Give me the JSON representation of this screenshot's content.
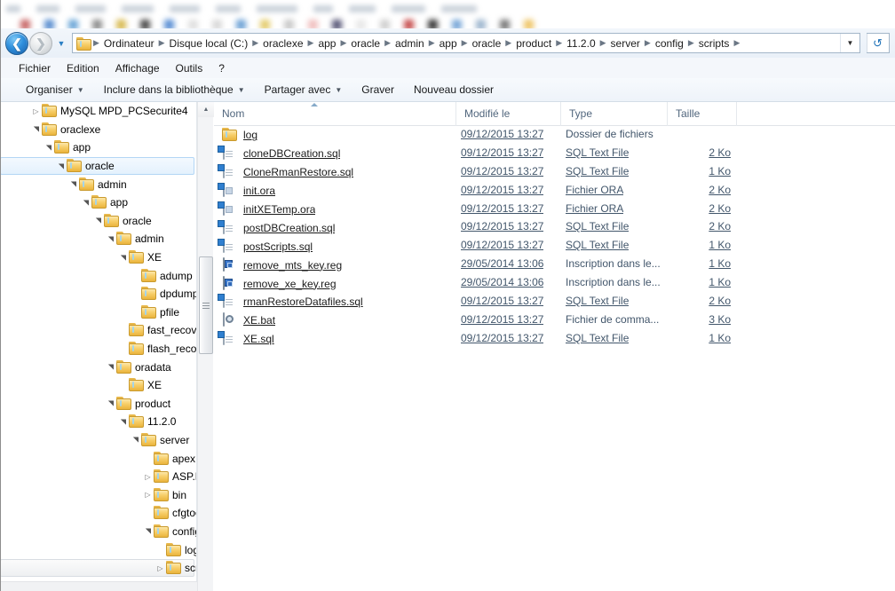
{
  "window": {
    "blur_tabs": [
      "",
      "",
      "",
      "",
      "",
      "",
      "",
      "",
      "",
      ""
    ]
  },
  "addressbar": {
    "back_icon": "arrow-left-icon",
    "forward_icon": "arrow-right-icon",
    "history_icon": "chevron-down-icon",
    "folder_icon": "folder-icon",
    "dropdown_icon": "chevron-down-icon",
    "refresh_icon": "refresh-icon",
    "breadcrumbs": [
      "Ordinateur",
      "Disque local (C:)",
      "oraclexe",
      "app",
      "oracle",
      "admin",
      "app",
      "oracle",
      "product",
      "11.2.0",
      "server",
      "config",
      "scripts"
    ]
  },
  "menubar": {
    "items": [
      "Fichier",
      "Edition",
      "Affichage",
      "Outils",
      "?"
    ]
  },
  "toolbar": {
    "items": [
      {
        "label": "Organiser",
        "caret": true
      },
      {
        "label": "Inclure dans la bibliothèque",
        "caret": true
      },
      {
        "label": "Partager avec",
        "caret": true
      },
      {
        "label": "Graver",
        "caret": false
      },
      {
        "label": "Nouveau dossier",
        "caret": false
      }
    ]
  },
  "tree": {
    "scroll_up_icon": "triangle-up-icon",
    "items": [
      {
        "label": "MySQL MPD_PCSecurite4",
        "indent": 2,
        "twisty": "collapsed",
        "state": "normal"
      },
      {
        "label": "oraclexe",
        "indent": 2,
        "twisty": "expanded",
        "state": "normal"
      },
      {
        "label": "app",
        "indent": 3,
        "twisty": "expanded",
        "state": "normal"
      },
      {
        "label": "oracle",
        "indent": 4,
        "twisty": "expanded",
        "state": "selected"
      },
      {
        "label": "admin",
        "indent": 5,
        "twisty": "expanded",
        "state": "normal"
      },
      {
        "label": "app",
        "indent": 6,
        "twisty": "expanded",
        "state": "normal"
      },
      {
        "label": "oracle",
        "indent": 7,
        "twisty": "expanded",
        "state": "normal"
      },
      {
        "label": "admin",
        "indent": 8,
        "twisty": "expanded",
        "state": "normal"
      },
      {
        "label": "XE",
        "indent": 9,
        "twisty": "expanded",
        "state": "normal"
      },
      {
        "label": "adump",
        "indent": 10,
        "twisty": "none",
        "state": "normal"
      },
      {
        "label": "dpdump",
        "indent": 10,
        "twisty": "none",
        "state": "normal"
      },
      {
        "label": "pfile",
        "indent": 10,
        "twisty": "none",
        "state": "normal"
      },
      {
        "label": "fast_recovery_a",
        "indent": 9,
        "twisty": "none",
        "state": "normal"
      },
      {
        "label": "flash_recovery_",
        "indent": 9,
        "twisty": "none",
        "state": "normal"
      },
      {
        "label": "oradata",
        "indent": 8,
        "twisty": "expanded",
        "state": "normal"
      },
      {
        "label": "XE",
        "indent": 9,
        "twisty": "none",
        "state": "normal"
      },
      {
        "label": "product",
        "indent": 8,
        "twisty": "expanded",
        "state": "normal"
      },
      {
        "label": "11.2.0",
        "indent": 9,
        "twisty": "expanded",
        "state": "normal"
      },
      {
        "label": "server",
        "indent": 10,
        "twisty": "expanded",
        "state": "normal"
      },
      {
        "label": "apex",
        "indent": 11,
        "twisty": "none",
        "state": "normal"
      },
      {
        "label": "ASP.NET",
        "indent": 11,
        "twisty": "collapsed",
        "state": "normal"
      },
      {
        "label": "bin",
        "indent": 11,
        "twisty": "collapsed",
        "state": "normal"
      },
      {
        "label": "cfgtoollog",
        "indent": 11,
        "twisty": "none",
        "state": "normal"
      },
      {
        "label": "config",
        "indent": 11,
        "twisty": "expanded",
        "state": "normal"
      },
      {
        "label": "log",
        "indent": 12,
        "twisty": "none",
        "state": "normal"
      },
      {
        "label": "scripts",
        "indent": 12,
        "twisty": "collapsed",
        "state": "hovered"
      }
    ]
  },
  "filelist": {
    "columns": [
      {
        "key": "name",
        "label": "Nom",
        "sorted": true
      },
      {
        "key": "date",
        "label": "Modifié le",
        "sorted": false
      },
      {
        "key": "type",
        "label": "Type",
        "sorted": false
      },
      {
        "key": "size",
        "label": "Taille",
        "sorted": false
      }
    ],
    "rows": [
      {
        "name": "log",
        "date": "09/12/2015 13:27",
        "type": "Dossier de fichiers",
        "size": "",
        "icon": "folder-icon"
      },
      {
        "name": "cloneDBCreation.sql",
        "date": "09/12/2015 13:27",
        "type": "SQL Text File",
        "size": "2 Ko",
        "icon": "sql-file-icon"
      },
      {
        "name": "CloneRmanRestore.sql",
        "date": "09/12/2015 13:27",
        "type": "SQL Text File",
        "size": "1 Ko",
        "icon": "sql-file-icon"
      },
      {
        "name": "init.ora",
        "date": "09/12/2015 13:27",
        "type": "Fichier ORA",
        "size": "2 Ko",
        "icon": "ora-file-icon"
      },
      {
        "name": "initXETemp.ora",
        "date": "09/12/2015 13:27",
        "type": "Fichier ORA",
        "size": "2 Ko",
        "icon": "ora-file-icon"
      },
      {
        "name": "postDBCreation.sql",
        "date": "09/12/2015 13:27",
        "type": "SQL Text File",
        "size": "2 Ko",
        "icon": "sql-file-icon"
      },
      {
        "name": "postScripts.sql",
        "date": "09/12/2015 13:27",
        "type": "SQL Text File",
        "size": "1 Ko",
        "icon": "sql-file-icon"
      },
      {
        "name": "remove_mts_key.reg",
        "date": "29/05/2014 13:06",
        "type": "Inscription dans le...",
        "size": "1 Ko",
        "icon": "registry-file-icon"
      },
      {
        "name": "remove_xe_key.reg",
        "date": "29/05/2014 13:06",
        "type": "Inscription dans le...",
        "size": "1 Ko",
        "icon": "registry-file-icon"
      },
      {
        "name": "rmanRestoreDatafiles.sql",
        "date": "09/12/2015 13:27",
        "type": "SQL Text File",
        "size": "2 Ko",
        "icon": "sql-file-icon"
      },
      {
        "name": "XE.bat",
        "date": "09/12/2015 13:27",
        "type": "Fichier de comma...",
        "size": "3 Ko",
        "icon": "bat-file-icon"
      },
      {
        "name": "XE.sql",
        "date": "09/12/2015 13:27",
        "type": "SQL Text File",
        "size": "1 Ko",
        "icon": "sql-file-icon"
      }
    ]
  },
  "colors": {
    "accent": "#2f7fd0",
    "folder": "#f0c552",
    "header_text": "#51667d",
    "selection": "#e4f1fd"
  }
}
